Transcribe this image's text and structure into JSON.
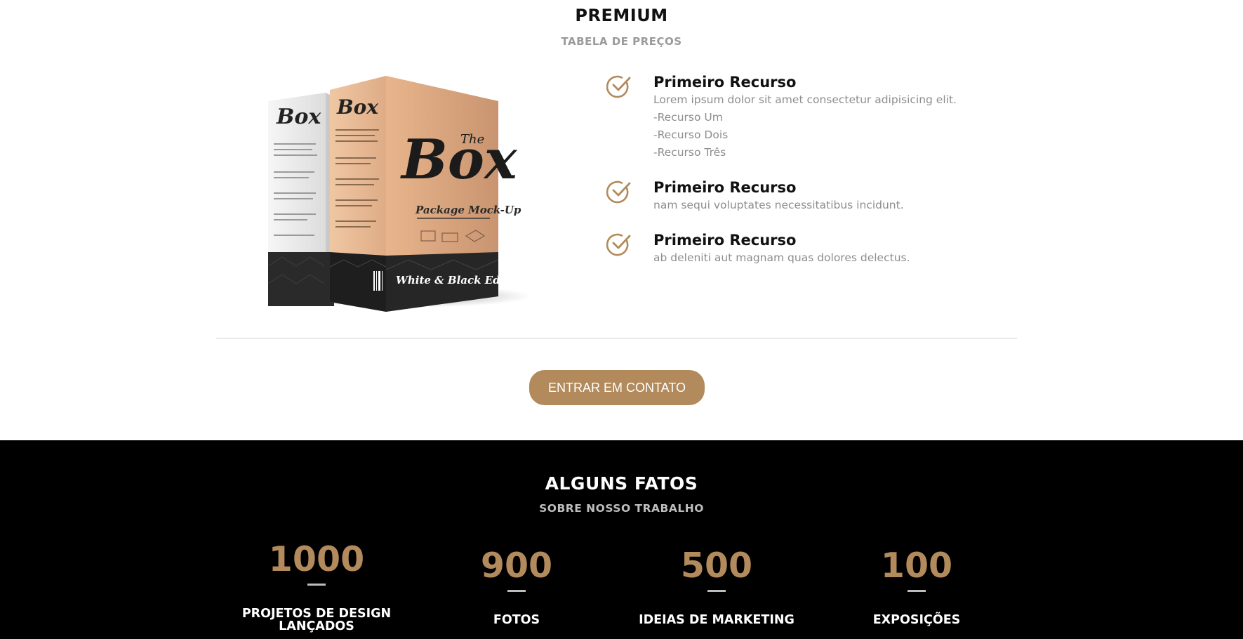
{
  "colors": {
    "accent": "#b28a5c",
    "dark_bg": "#000000",
    "muted_text": "#8d8d8d"
  },
  "premium": {
    "title": "PREMIUM",
    "subtitle": "TABELA DE PREÇOS",
    "image": {
      "icon": "product-box-image",
      "box_front_title": "The Box",
      "box_caption": "Package Mock-Up",
      "box_edition": "White & Black Edition"
    },
    "features": [
      {
        "icon": "check-circle-icon",
        "title": "Primeiro Recurso",
        "lines": [
          "Lorem ipsum dolor sit amet consectetur adipisicing elit.",
          "-Recurso Um",
          "-Recurso Dois",
          "-Recurso Três"
        ]
      },
      {
        "icon": "check-circle-icon",
        "title": "Primeiro Recurso",
        "lines": [
          "nam sequi voluptates necessitatibus incidunt."
        ]
      },
      {
        "icon": "check-circle-icon",
        "title": "Primeiro Recurso",
        "lines": [
          "ab deleniti aut magnam quas dolores delectus."
        ]
      }
    ],
    "cta_label": "ENTRAR EM CONTATO"
  },
  "facts": {
    "title": "ALGUNS FATOS",
    "subtitle": "SOBRE NOSSO TRABALHO",
    "stats": [
      {
        "value": "1000",
        "label": "PROJETOS DE DESIGN LANÇADOS"
      },
      {
        "value": "900",
        "label": "FOTOS"
      },
      {
        "value": "500",
        "label": "IDEIAS DE MARKETING"
      },
      {
        "value": "100",
        "label": "EXPOSIÇÕES"
      }
    ]
  }
}
